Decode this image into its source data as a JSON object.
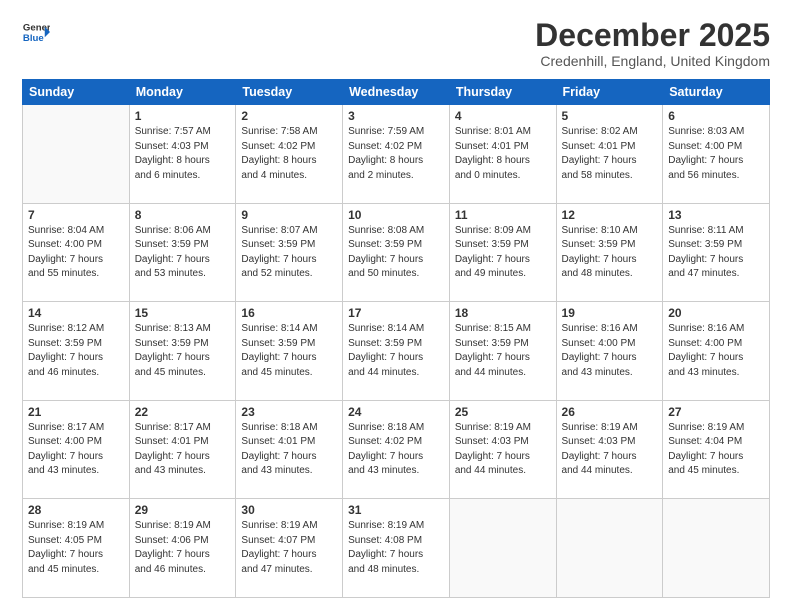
{
  "header": {
    "logo_line1": "General",
    "logo_line2": "Blue",
    "month_title": "December 2025",
    "location": "Credenhill, England, United Kingdom"
  },
  "weekdays": [
    "Sunday",
    "Monday",
    "Tuesday",
    "Wednesday",
    "Thursday",
    "Friday",
    "Saturday"
  ],
  "weeks": [
    [
      {
        "day": "",
        "info": ""
      },
      {
        "day": "1",
        "info": "Sunrise: 7:57 AM\nSunset: 4:03 PM\nDaylight: 8 hours\nand 6 minutes."
      },
      {
        "day": "2",
        "info": "Sunrise: 7:58 AM\nSunset: 4:02 PM\nDaylight: 8 hours\nand 4 minutes."
      },
      {
        "day": "3",
        "info": "Sunrise: 7:59 AM\nSunset: 4:02 PM\nDaylight: 8 hours\nand 2 minutes."
      },
      {
        "day": "4",
        "info": "Sunrise: 8:01 AM\nSunset: 4:01 PM\nDaylight: 8 hours\nand 0 minutes."
      },
      {
        "day": "5",
        "info": "Sunrise: 8:02 AM\nSunset: 4:01 PM\nDaylight: 7 hours\nand 58 minutes."
      },
      {
        "day": "6",
        "info": "Sunrise: 8:03 AM\nSunset: 4:00 PM\nDaylight: 7 hours\nand 56 minutes."
      }
    ],
    [
      {
        "day": "7",
        "info": "Sunrise: 8:04 AM\nSunset: 4:00 PM\nDaylight: 7 hours\nand 55 minutes."
      },
      {
        "day": "8",
        "info": "Sunrise: 8:06 AM\nSunset: 3:59 PM\nDaylight: 7 hours\nand 53 minutes."
      },
      {
        "day": "9",
        "info": "Sunrise: 8:07 AM\nSunset: 3:59 PM\nDaylight: 7 hours\nand 52 minutes."
      },
      {
        "day": "10",
        "info": "Sunrise: 8:08 AM\nSunset: 3:59 PM\nDaylight: 7 hours\nand 50 minutes."
      },
      {
        "day": "11",
        "info": "Sunrise: 8:09 AM\nSunset: 3:59 PM\nDaylight: 7 hours\nand 49 minutes."
      },
      {
        "day": "12",
        "info": "Sunrise: 8:10 AM\nSunset: 3:59 PM\nDaylight: 7 hours\nand 48 minutes."
      },
      {
        "day": "13",
        "info": "Sunrise: 8:11 AM\nSunset: 3:59 PM\nDaylight: 7 hours\nand 47 minutes."
      }
    ],
    [
      {
        "day": "14",
        "info": "Sunrise: 8:12 AM\nSunset: 3:59 PM\nDaylight: 7 hours\nand 46 minutes."
      },
      {
        "day": "15",
        "info": "Sunrise: 8:13 AM\nSunset: 3:59 PM\nDaylight: 7 hours\nand 45 minutes."
      },
      {
        "day": "16",
        "info": "Sunrise: 8:14 AM\nSunset: 3:59 PM\nDaylight: 7 hours\nand 45 minutes."
      },
      {
        "day": "17",
        "info": "Sunrise: 8:14 AM\nSunset: 3:59 PM\nDaylight: 7 hours\nand 44 minutes."
      },
      {
        "day": "18",
        "info": "Sunrise: 8:15 AM\nSunset: 3:59 PM\nDaylight: 7 hours\nand 44 minutes."
      },
      {
        "day": "19",
        "info": "Sunrise: 8:16 AM\nSunset: 4:00 PM\nDaylight: 7 hours\nand 43 minutes."
      },
      {
        "day": "20",
        "info": "Sunrise: 8:16 AM\nSunset: 4:00 PM\nDaylight: 7 hours\nand 43 minutes."
      }
    ],
    [
      {
        "day": "21",
        "info": "Sunrise: 8:17 AM\nSunset: 4:00 PM\nDaylight: 7 hours\nand 43 minutes."
      },
      {
        "day": "22",
        "info": "Sunrise: 8:17 AM\nSunset: 4:01 PM\nDaylight: 7 hours\nand 43 minutes."
      },
      {
        "day": "23",
        "info": "Sunrise: 8:18 AM\nSunset: 4:01 PM\nDaylight: 7 hours\nand 43 minutes."
      },
      {
        "day": "24",
        "info": "Sunrise: 8:18 AM\nSunset: 4:02 PM\nDaylight: 7 hours\nand 43 minutes."
      },
      {
        "day": "25",
        "info": "Sunrise: 8:19 AM\nSunset: 4:03 PM\nDaylight: 7 hours\nand 44 minutes."
      },
      {
        "day": "26",
        "info": "Sunrise: 8:19 AM\nSunset: 4:03 PM\nDaylight: 7 hours\nand 44 minutes."
      },
      {
        "day": "27",
        "info": "Sunrise: 8:19 AM\nSunset: 4:04 PM\nDaylight: 7 hours\nand 45 minutes."
      }
    ],
    [
      {
        "day": "28",
        "info": "Sunrise: 8:19 AM\nSunset: 4:05 PM\nDaylight: 7 hours\nand 45 minutes."
      },
      {
        "day": "29",
        "info": "Sunrise: 8:19 AM\nSunset: 4:06 PM\nDaylight: 7 hours\nand 46 minutes."
      },
      {
        "day": "30",
        "info": "Sunrise: 8:19 AM\nSunset: 4:07 PM\nDaylight: 7 hours\nand 47 minutes."
      },
      {
        "day": "31",
        "info": "Sunrise: 8:19 AM\nSunset: 4:08 PM\nDaylight: 7 hours\nand 48 minutes."
      },
      {
        "day": "",
        "info": ""
      },
      {
        "day": "",
        "info": ""
      },
      {
        "day": "",
        "info": ""
      }
    ]
  ]
}
